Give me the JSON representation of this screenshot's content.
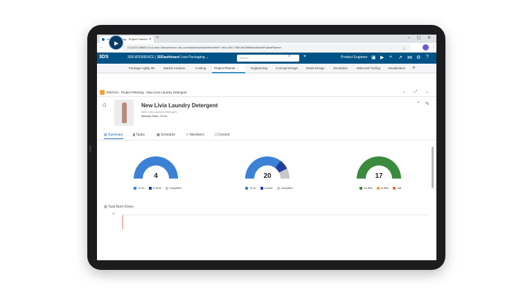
{
  "browser": {
    "tab_title": "Livia Packaging - Project Planner",
    "new_tab": "+",
    "window_controls": "– ▢ ✕",
    "url": "r1132101358812-eu1-ifwe.3dexperience.3ds.com/#dashboard/a4b9cddbfe7-9ecf-4b07-93fb-fe0d5f89e6c8/tab/ProjectPlanner",
    "nav_icons": "← → ⟳ ⌂"
  },
  "topbar": {
    "logo": "3DS",
    "brand_prefix": "3DEXPERIENCE",
    "brand_app": "3DDashboard",
    "brand_space": "Livia Packaging",
    "search_placeholder": "Search",
    "user_role": "Product Engineer"
  },
  "app_tabs": [
    {
      "label": "Package Agility 3D"
    },
    {
      "label": "Market Analysis"
    },
    {
      "label": "Costing"
    },
    {
      "label": "Project Planner"
    },
    {
      "label": "Engineering"
    },
    {
      "label": "Concept Design"
    },
    {
      "label": "Detail Design"
    },
    {
      "label": "Simulation"
    },
    {
      "label": "Mold and Tooling"
    },
    {
      "label": "Visualization"
    }
  ],
  "widget": {
    "title": "ENOVIA - Project Planning - New Livia Laundry Detergent"
  },
  "project": {
    "title": "New Livia Laundry Detergent",
    "subtitle": "New Livia Laundry Detergent",
    "maturity": "Maturity State: To Do"
  },
  "content_tabs": [
    {
      "label": "Summary",
      "icon": "chart-icon"
    },
    {
      "label": "Tasks",
      "icon": "clipboard-icon"
    },
    {
      "label": "Schedule",
      "icon": "calendar-icon"
    },
    {
      "label": "Members",
      "icon": "people-icon"
    },
    {
      "label": "Content",
      "icon": "document-icon"
    }
  ],
  "gauges": [
    {
      "value": "4",
      "segments": [
        1,
        0,
        0
      ],
      "colors": [
        "#3b82d6",
        "#1e3f9a",
        "#c8c8c8"
      ],
      "legend": [
        "To Do",
        "In Work",
        "Completed"
      ]
    },
    {
      "value": "20",
      "segments": [
        0.7,
        0.15,
        0.15
      ],
      "colors": [
        "#3b82d6",
        "#1e3f9a",
        "#c8c8c8"
      ],
      "legend": [
        "To Do",
        "In Work",
        "Completed"
      ]
    },
    {
      "value": "17",
      "segments": [
        1,
        0,
        0
      ],
      "colors": [
        "#3b8a3e",
        "#f2a33a",
        "#e8721c"
      ],
      "legend": [
        "No Risk",
        "At Risk",
        "Late"
      ]
    }
  ],
  "burndown": {
    "title": "Task Burn-Down",
    "tick": "20"
  }
}
